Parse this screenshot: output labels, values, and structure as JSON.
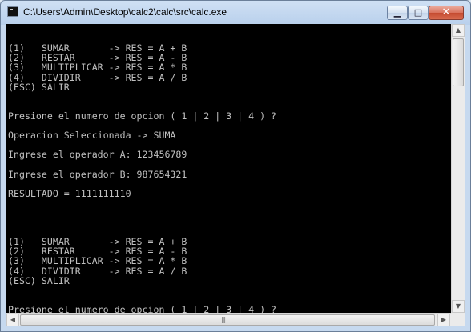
{
  "window": {
    "title": "C:\\Users\\Admin\\Desktop\\calc2\\calc\\src\\calc.exe",
    "minimize_glyph": "▁",
    "maximize_glyph": "□",
    "close_glyph": "✕",
    "icon": "console-icon"
  },
  "console": {
    "lines": [
      "",
      "",
      "(1)   SUMAR       -> RES = A + B",
      "(2)   RESTAR      -> RES = A - B",
      "(3)   MULTIPLICAR -> RES = A * B",
      "(4)   DIVIDIR     -> RES = A / B",
      "(ESC) SALIR",
      "",
      "",
      "Presione el numero de opcion ( 1 | 2 | 3 | 4 ) ?",
      "",
      "Operacion Seleccionada -> SUMA",
      "",
      "Ingrese el operador A: 123456789",
      "",
      "Ingrese el operador B: 987654321",
      "",
      "RESULTADO = 1111111110",
      "",
      "",
      "",
      "",
      "(1)   SUMAR       -> RES = A + B",
      "(2)   RESTAR      -> RES = A - B",
      "(3)   MULTIPLICAR -> RES = A * B",
      "(4)   DIVIDIR     -> RES = A / B",
      "(ESC) SALIR",
      "",
      "",
      "Presione el numero de opcion ( 1 | 2 | 3 | 4 ) ?"
    ]
  },
  "scrollbars": {
    "up_arrow": "▲",
    "down_arrow": "▼",
    "left_arrow": "◀",
    "right_arrow": "▶",
    "grip": "|||"
  }
}
